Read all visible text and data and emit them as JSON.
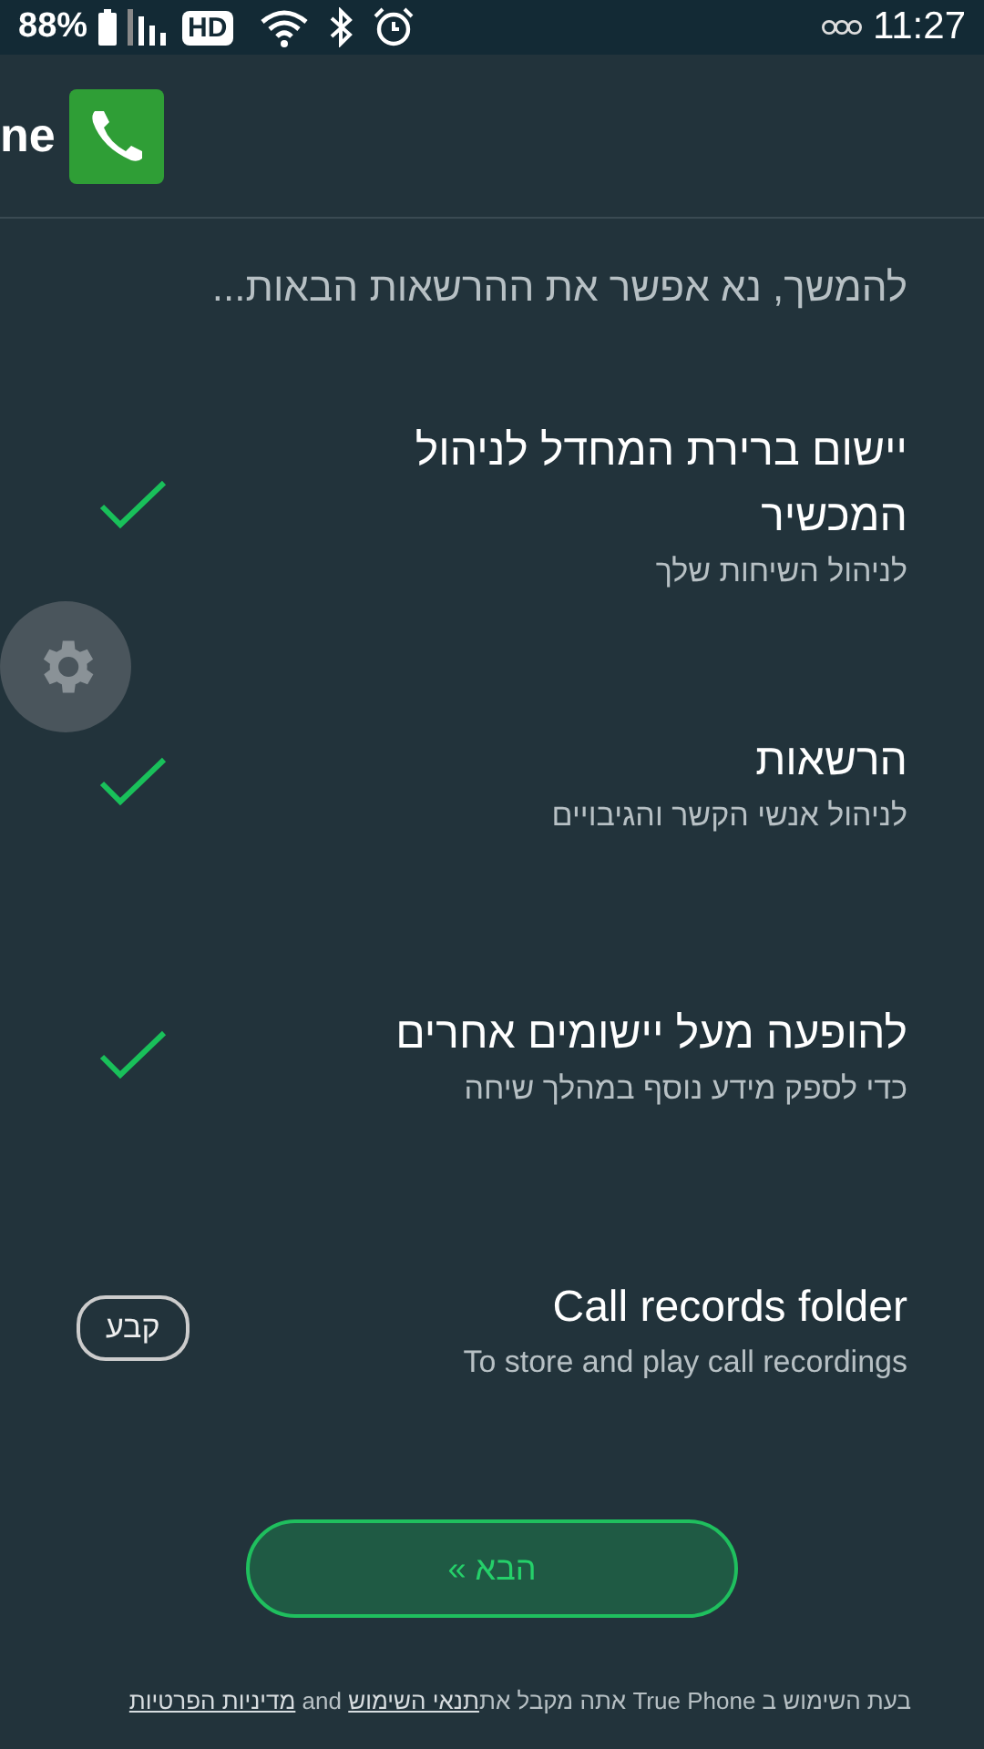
{
  "status_bar": {
    "battery": "88%",
    "network_badge": "HD",
    "time": "11:27"
  },
  "header": {
    "title": "ne"
  },
  "intro": "להמשך, נא אפשר את ההרשאות הבאות...",
  "permissions": [
    {
      "kind": "check",
      "title": "יישום ברירת המחדל לניהול המכשיר",
      "subtitle": "לניהול השיחות שלך",
      "granted": true
    },
    {
      "kind": "check",
      "title": "הרשאות",
      "subtitle": "לניהול אנשי הקשר והגיבויים",
      "granted": true
    },
    {
      "kind": "check",
      "title": "להופעה מעל יישומים אחרים",
      "subtitle": "כדי לספק מידע נוסף במהלך שיחה",
      "granted": true
    },
    {
      "kind": "button",
      "title": "Call records folder",
      "subtitle": "To store and play call recordings",
      "button": "קבע"
    }
  ],
  "next_button": "הבא »",
  "footer": {
    "text": "בעת השימוש ב True Phone אתה מקבל את",
    "terms_link": "תנאי השימוש",
    "joiner": "and",
    "privacy_link": "מדיניות הפרטיות"
  }
}
